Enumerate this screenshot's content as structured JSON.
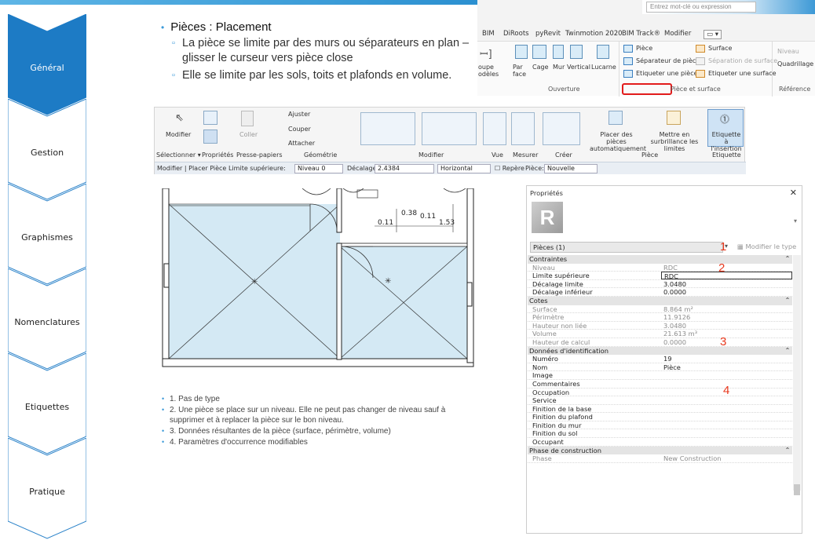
{
  "nav": [
    {
      "label": "Général",
      "active": true
    },
    {
      "label": "Gestion",
      "active": false
    },
    {
      "label": "Graphismes",
      "active": false
    },
    {
      "label": "Nomenclatures",
      "active": false
    },
    {
      "label": "Etiquettes",
      "active": false
    },
    {
      "label": "Pratique",
      "active": false
    }
  ],
  "slide": {
    "heading": "Pièces : Placement",
    "sub1": "La pièce se limite par des murs ou séparateurs en plan – glisser le curseur vers pièce close",
    "sub2": "Elle se limite par les sols, toits et plafonds en volume."
  },
  "ribbon_top": {
    "search_placeholder": "Entrez mot-clé ou expression",
    "tabs": [
      "BIM",
      "DiRoots",
      "pyRevit",
      "Twinmotion 2020",
      "BIM Track®",
      "Modifier"
    ],
    "panel_ouverture": "Ouverture",
    "btn_modeles": "oupe\nodèles",
    "btn_par_face": "Par\nface",
    "btn_cage": "Cage",
    "btn_mur": "Mur",
    "btn_vertical": "Vertical",
    "btn_lucarne": "Lucarne",
    "btn_piece": "Pièce",
    "btn_separateur": "Séparateur de pièces",
    "btn_etiqueter_piece": "Etiqueter une pièce",
    "btn_surface": "Surface",
    "btn_separation_surface": "Séparation de surface",
    "btn_etiqueter_surface": "Etiqueter une surface",
    "panel_piece_surface": "Pièce et surface",
    "btn_niveau": "Niveau",
    "btn_quadrillage": "Quadrillage",
    "panel_reference": "Référence"
  },
  "ribbon_main": {
    "btn_modifier": "Modifier",
    "btn_coller": "Coller",
    "btn_ajuster": "Ajuster",
    "btn_couper": "Couper",
    "btn_attacher": "Attacher",
    "btn_placer_auto": "Placer des pièces automatiquement",
    "btn_surbrillance": "Mettre en surbrillance les limites",
    "btn_etiquette_insertion": "Etiquette à l'insertion",
    "panels": [
      "Sélectionner ▾",
      "Propriétés",
      "Presse-papiers",
      "Géométrie",
      "Modifier",
      "Vue",
      "Mesurer",
      "Créer",
      "Pièce",
      "Etiquette"
    ],
    "context_label": "Modifier | Placer Pièce",
    "limite_sup_label": "Limite supérieure:",
    "limite_sup_value": "Niveau 0",
    "decalage_label": "Décalage:",
    "decalage_value": "2.4384",
    "orientation": "Horizontal",
    "repere_label": "Repère",
    "piece_label": "Pièce:",
    "piece_value": "Nouvelle"
  },
  "plan": {
    "dim1": "0.38",
    "dim2": "0.11",
    "dim3": "0.11",
    "dim4": "1.53"
  },
  "properties": {
    "title": "Propriétés",
    "logo": "R",
    "selector": "Pièces (1)",
    "edit_type": "Modifier le type",
    "rows": [
      {
        "k": "Contraintes",
        "v": "",
        "type": "grp"
      },
      {
        "k": "Niveau",
        "v": "RDC",
        "type": "dim"
      },
      {
        "k": "Limite supérieure",
        "v": "RDC",
        "type": "box"
      },
      {
        "k": "Décalage limite",
        "v": "3.0480",
        "type": ""
      },
      {
        "k": "Décalage inférieur",
        "v": "0.0000",
        "type": ""
      },
      {
        "k": "Cotes",
        "v": "",
        "type": "grp"
      },
      {
        "k": "Surface",
        "v": "8.864 m²",
        "type": "dim"
      },
      {
        "k": "Périmètre",
        "v": "11.9126",
        "type": "dim"
      },
      {
        "k": "Hauteur non liée",
        "v": "3.0480",
        "type": "dim"
      },
      {
        "k": "Volume",
        "v": "21.613 m³",
        "type": "dim"
      },
      {
        "k": "Hauteur de calcul",
        "v": "0.0000",
        "type": "dim"
      },
      {
        "k": "Données d'identification",
        "v": "",
        "type": "grp"
      },
      {
        "k": "Numéro",
        "v": "19",
        "type": ""
      },
      {
        "k": "Nom",
        "v": "Pièce",
        "type": ""
      },
      {
        "k": "Image",
        "v": "",
        "type": ""
      },
      {
        "k": "Commentaires",
        "v": "",
        "type": ""
      },
      {
        "k": "Occupation",
        "v": "",
        "type": ""
      },
      {
        "k": "Service",
        "v": "",
        "type": ""
      },
      {
        "k": "Finition de la base",
        "v": "",
        "type": ""
      },
      {
        "k": "Finition du plafond",
        "v": "",
        "type": ""
      },
      {
        "k": "Finition du mur",
        "v": "",
        "type": ""
      },
      {
        "k": "Finition du sol",
        "v": "",
        "type": ""
      },
      {
        "k": "Occupant",
        "v": "",
        "type": ""
      },
      {
        "k": "Phase de construction",
        "v": "",
        "type": "grp"
      },
      {
        "k": "Phase",
        "v": "New Construction",
        "type": "dim"
      }
    ],
    "markers": [
      "1",
      "2",
      "3",
      "4"
    ]
  },
  "notes": [
    "1. Pas de type",
    "2. Une pièce se place sur un niveau. Elle ne peut pas changer de niveau sauf à supprimer et à replacer la pièce sur le bon niveau.",
    "3. Données résultantes de la pièce (surface, périmètre, volume)",
    "4. Paramètres d'occurrence modifiables"
  ],
  "colors": {
    "accent": "#2a82c9",
    "marker": "#e8381d",
    "room_fill": "#d3e8f3"
  }
}
